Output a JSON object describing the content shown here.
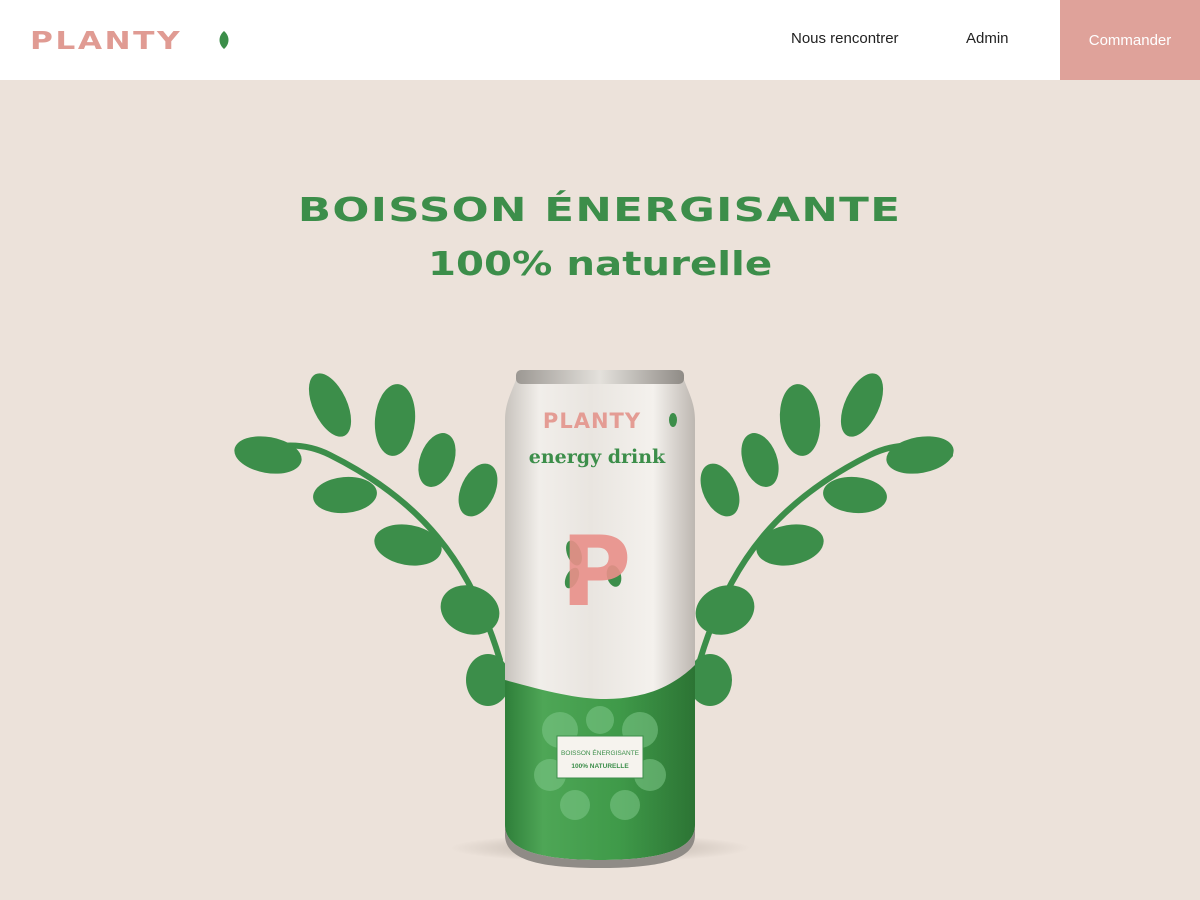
{
  "header": {
    "logo_text": "PLANTY",
    "nav": {
      "rencontrer": "Nous rencontrer",
      "admin": "Admin"
    },
    "cta_label": "Commander"
  },
  "hero": {
    "title_line1": "BOISSON ÉNERGISANTE",
    "title_line2": "100% naturelle"
  },
  "can": {
    "brand": "PLANTY",
    "subtitle": "energy drink",
    "monogram": "P",
    "label_line1": "BOISSON ÉNERGISANTE",
    "label_line2": "100% NATURELLE"
  },
  "colors": {
    "background": "#ece2da",
    "brand_pink": "#e09b93",
    "cta_pink": "#dfa29a",
    "brand_green": "#3c8e4a"
  }
}
